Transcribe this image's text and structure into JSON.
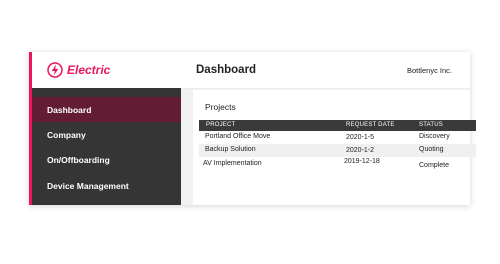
{
  "brand": {
    "name": "Electric",
    "icon": "lightning-bolt-icon",
    "accent_color": "#e8175d"
  },
  "header": {
    "title": "Dashboard",
    "company": "Bottlenyc Inc."
  },
  "sidebar": {
    "items": [
      {
        "label": "Dashboard",
        "active": true
      },
      {
        "label": "Company",
        "active": false
      },
      {
        "label": "On/Offboarding",
        "active": false
      },
      {
        "label": "Device Management",
        "active": false
      }
    ]
  },
  "main": {
    "section_title": "Projects",
    "columns": [
      "PROJECT",
      "REQUEST DATE",
      "STATUS"
    ],
    "rows": [
      {
        "project": "Portland Office Move",
        "date": "2020-1-5",
        "status": "Discovery"
      },
      {
        "project": "Backup Solution",
        "date": "2020-1-2",
        "status": "Quoting"
      },
      {
        "project": "AV Implementation",
        "date": "2019-12-18",
        "status": "Complete"
      }
    ]
  }
}
